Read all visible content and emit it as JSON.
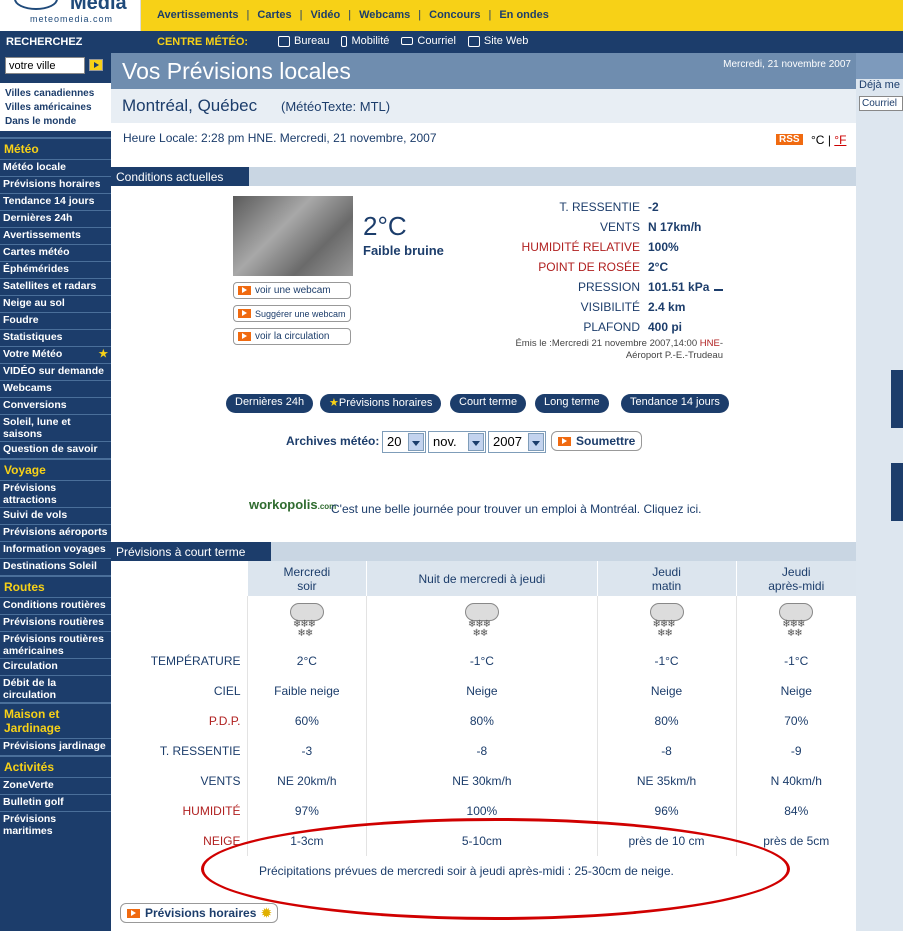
{
  "logo": {
    "word": "Média",
    "sub": "meteomedia.com"
  },
  "topnav": [
    "Avertissements",
    "Cartes",
    "Vidéo",
    "Webcams",
    "Concours",
    "En ondes"
  ],
  "secbar": {
    "recherchez": "RECHERCHEZ",
    "centre": "CENTRE MÉTÉO:",
    "links": [
      "Bureau",
      "Mobilité",
      "Courriel",
      "Site Web"
    ]
  },
  "sidebar": {
    "search_value": "votre ville",
    "quick": [
      "Villes canadiennes",
      "Villes américaines",
      "Dans le monde"
    ],
    "sections": [
      {
        "title": "Météo",
        "items": [
          "Météo locale",
          "Prévisions horaires",
          "Tendance 14 jours",
          "Dernières 24h",
          "Avertissements",
          "Cartes météo",
          "Éphémérides",
          "Satellites et radars",
          "Neige au sol",
          "Foudre",
          "Statistiques",
          "Votre Météo",
          "VIDÉO sur demande",
          "Webcams",
          "Conversions",
          "Soleil, lune et saisons",
          "Question de savoir"
        ]
      },
      {
        "title": "Voyage",
        "items": [
          "Prévisions attractions",
          "Suivi de vols",
          "Prévisions aéroports",
          "Information voyages",
          "Destinations Soleil"
        ]
      },
      {
        "title": "Routes",
        "items": [
          "Conditions routières",
          "Prévisions routières",
          "Prévisions routières américaines",
          "Circulation",
          "Débit de la circulation"
        ]
      },
      {
        "title": "Maison et Jardinage",
        "items": [
          "Prévisions jardinage"
        ]
      },
      {
        "title": "Activités",
        "items": [
          "ZoneVerte",
          "Bulletin golf",
          "Prévisions maritimes"
        ]
      }
    ]
  },
  "banner": {
    "title": "Vos Prévisions locales",
    "date": "Mercredi, 21 novembre 2007"
  },
  "city": {
    "name": "Montréal, Québec",
    "meteotexte": "(MétéoTexte: MTL)"
  },
  "heure": "Heure Locale: 2:28 pm HNE. Mercredi, 21 novembre, 2007",
  "rss": "RSS",
  "units": {
    "c": "°C",
    "sep": "|",
    "f": "°F"
  },
  "current": {
    "header": "Conditions actuelles",
    "temp": "2°C",
    "condition": "Faible bruine",
    "buttons": [
      "voir une webcam",
      "Suggérer une webcam",
      "voir la circulation"
    ],
    "rows": [
      {
        "label": "T. RESSENTIE",
        "value": "-2"
      },
      {
        "label": "VENTS",
        "value": "N 17km/h"
      },
      {
        "label": "HUMIDITÉ RELATIVE",
        "value": "100%"
      },
      {
        "label": "POINT DE ROSÉE",
        "value": "2°C"
      },
      {
        "label": "PRESSION",
        "value": "101.51 kPa"
      },
      {
        "label": "VISIBILITÉ",
        "value": "2.4 km"
      },
      {
        "label": "PLAFOND",
        "value": "400 pi"
      }
    ],
    "emis_line1": "Émis le :Mercredi 21 novembre 2007,14:00",
    "emis_hne": "HNE",
    "emis_line2": "Aéroport P.-E.-Trudeau"
  },
  "pills": [
    "Dernières 24h",
    "Prévisions horaires",
    "Court terme",
    "Long terme",
    "Tendance 14 jours"
  ],
  "archives": {
    "label": "Archives météo:",
    "day": "20",
    "month": "nov.",
    "year": "2007",
    "submit": "Soumettre"
  },
  "workopolis": {
    "logo": "workopolis",
    "logo_suffix": ".com",
    "text": "C'est une belle journée pour trouver un emploi à Montréal. Cliquez ici."
  },
  "forecast": {
    "header": "Prévisions à court terme",
    "periods": [
      {
        "line1": "Mercredi",
        "line2": "soir"
      },
      {
        "line1": "Nuit de mercredi à jeudi",
        "line2": ""
      },
      {
        "line1": "Jeudi",
        "line2": "matin"
      },
      {
        "line1": "Jeudi",
        "line2": "après-midi"
      }
    ],
    "rows": [
      {
        "label": "TEMPÉRATURE",
        "values": [
          "2°C",
          "-1°C",
          "-1°C",
          "-1°C"
        ]
      },
      {
        "label": "CIEL",
        "values": [
          "Faible neige",
          "Neige",
          "Neige",
          "Neige"
        ]
      },
      {
        "label": "P.D.P.",
        "values": [
          "60%",
          "80%",
          "80%",
          "70%"
        ]
      },
      {
        "label": "T. RESSENTIE",
        "values": [
          "-3",
          "-8",
          "-8",
          "-9"
        ]
      },
      {
        "label": "VENTS",
        "values": [
          "NE 20km/h",
          "NE 30km/h",
          "NE 35km/h",
          "N 40km/h"
        ]
      },
      {
        "label": "HUMIDITÉ",
        "values": [
          "97%",
          "100%",
          "96%",
          "84%"
        ]
      },
      {
        "label": "NEIGE",
        "values": [
          "1-3cm",
          "5-10cm",
          "près de 10 cm",
          "près de 5cm"
        ]
      }
    ],
    "precip": "Précipitations prévues de mercredi soir à jeudi après-midi : 25-30cm de neige.",
    "hourly_button": "Prévisions horaires"
  },
  "right": {
    "deja": "Déjà me",
    "input": "Courriel"
  },
  "colors": {
    "navy": "#1c3d6b",
    "yellow": "#f7d117",
    "orange": "#f06a10",
    "red": "#b02020",
    "circle": "#d00000"
  }
}
